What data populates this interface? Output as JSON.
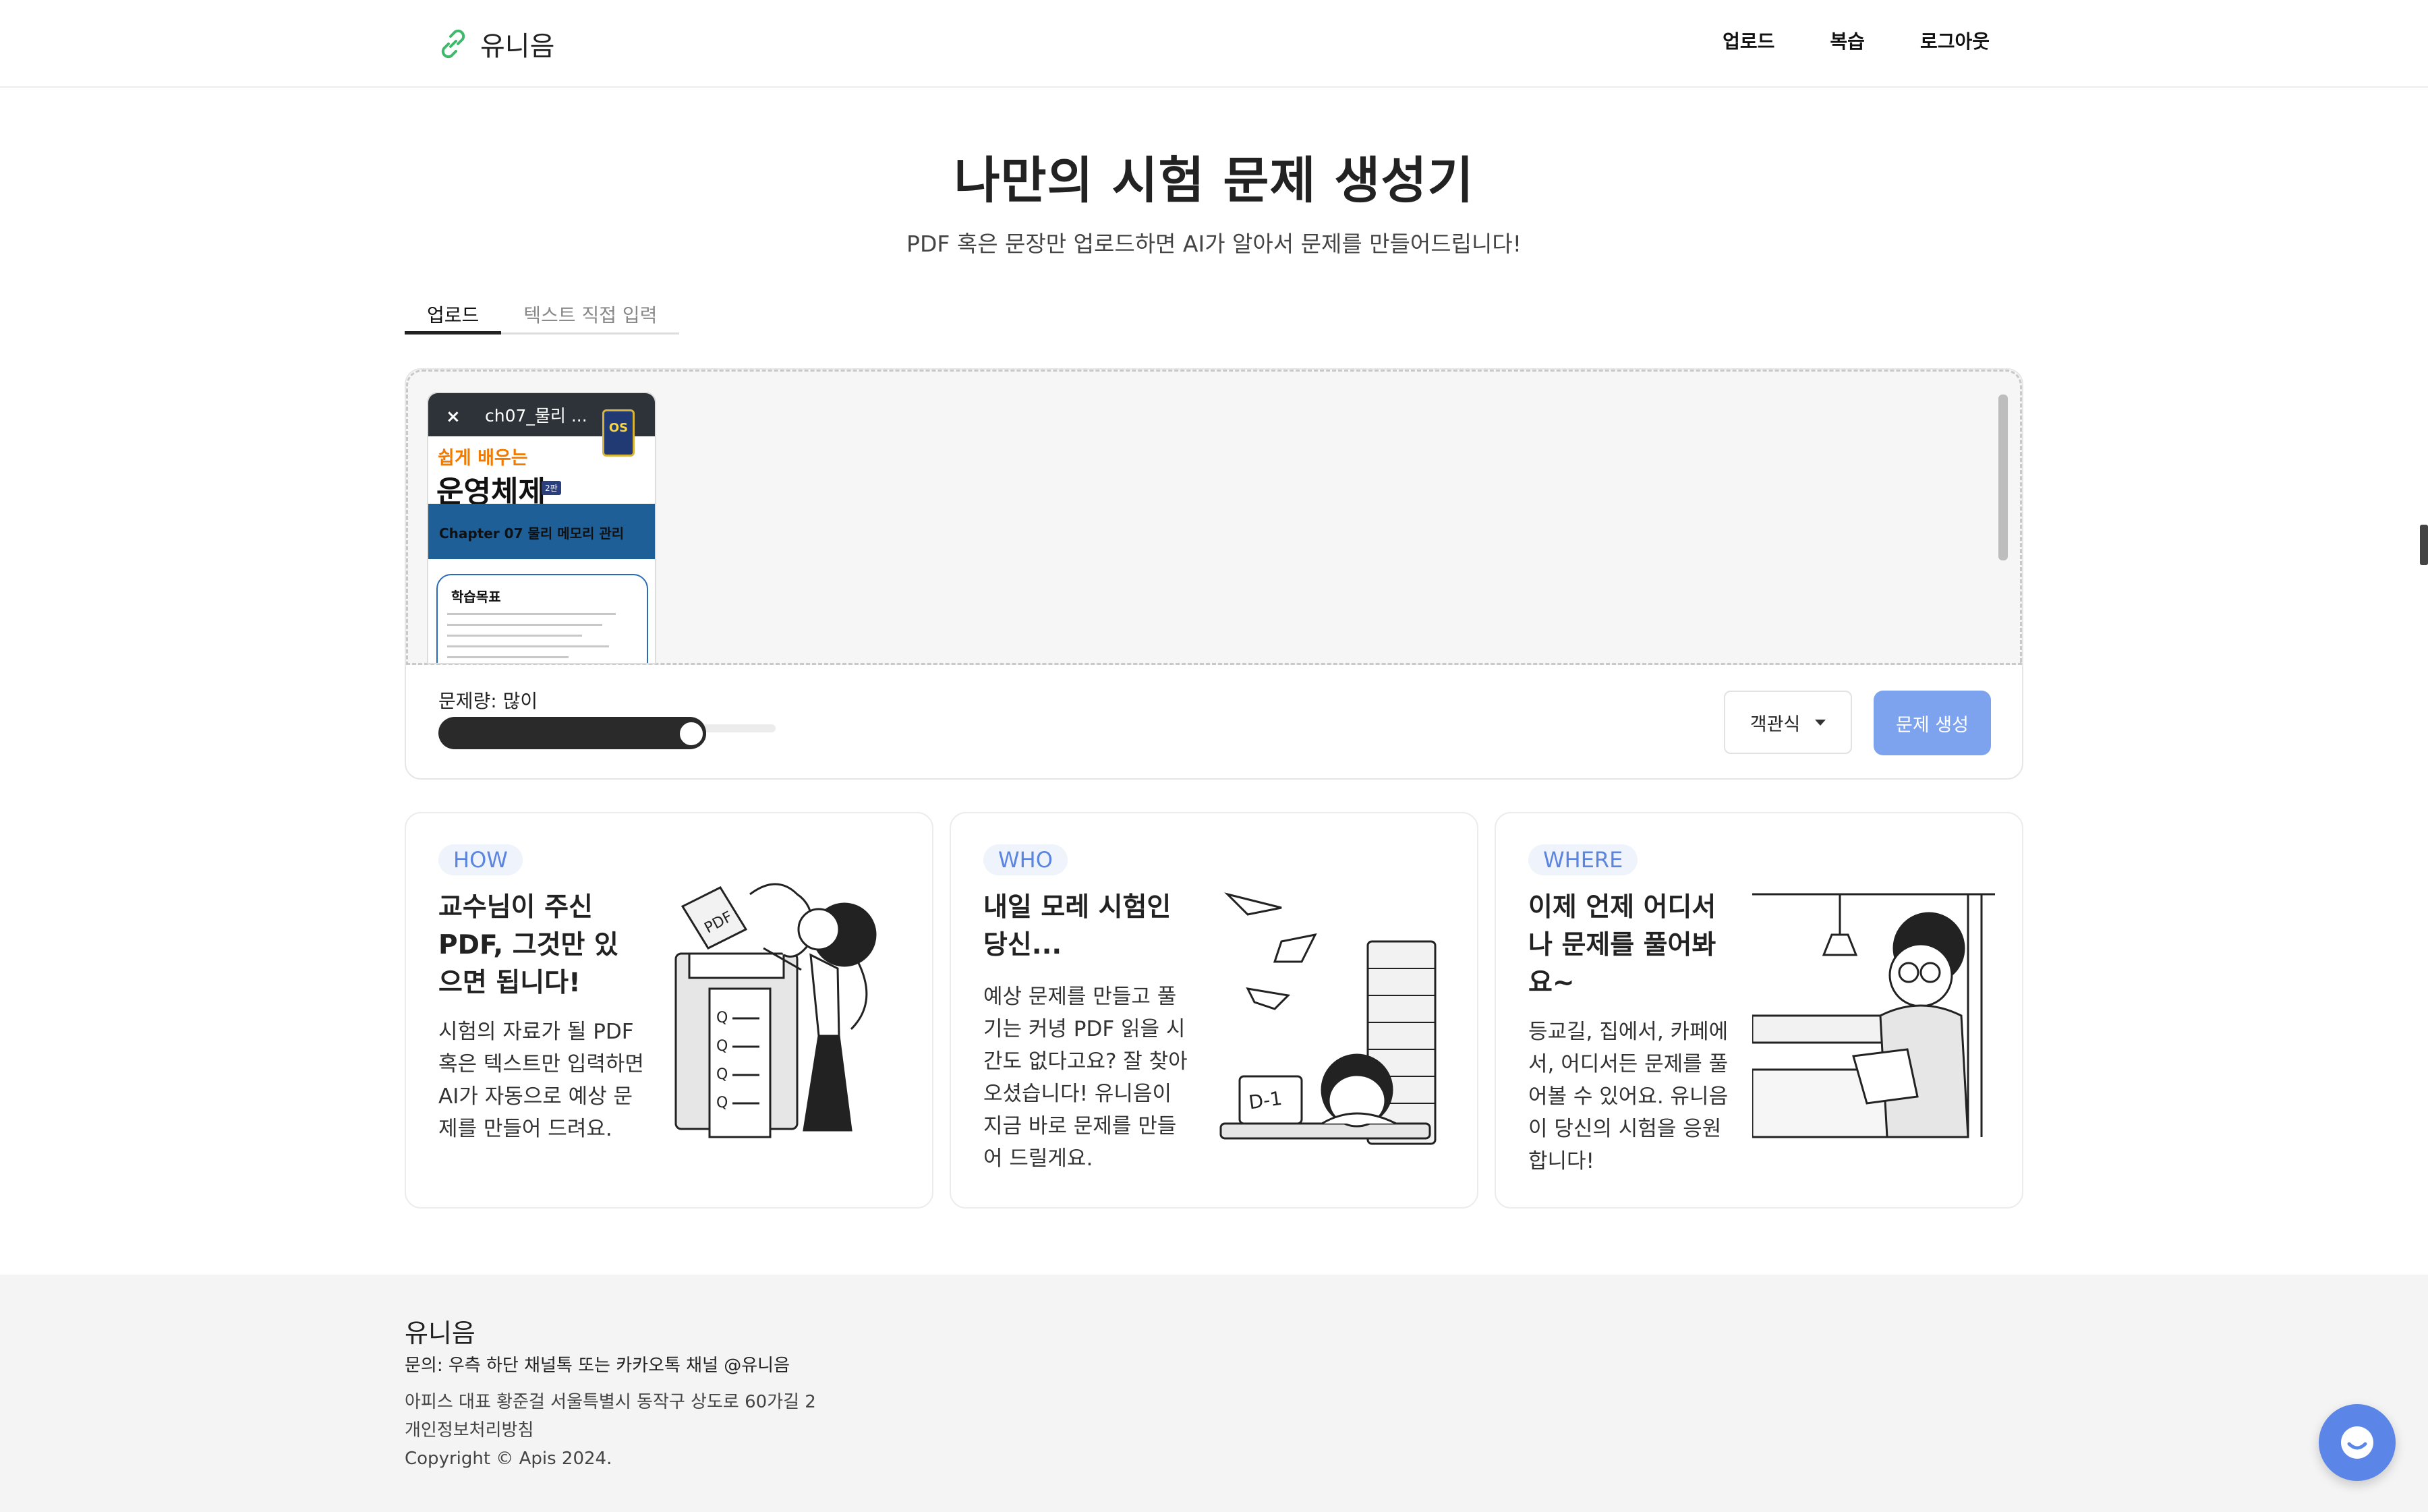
{
  "nav": {
    "brand": "유니음",
    "links": [
      "업로드",
      "복습",
      "로그아웃"
    ]
  },
  "hero": {
    "title": "나만의 시험 문제 생성기",
    "subtitle": "PDF 혹은 문장만 업로드하면 AI가 알아서 문제를 만들어드립니다!"
  },
  "tabs": [
    {
      "label": "업로드",
      "active": true
    },
    {
      "label": "텍스트 직접 입력",
      "active": false
    }
  ],
  "upload": {
    "file": {
      "name": "ch07_물리 ...",
      "close": "×",
      "thumb_badge": "OS",
      "thumb_subtitle": "쉽게 배우는",
      "thumb_title": "운영체제",
      "thumb_edition": "2판",
      "thumb_chapter": "Chapter 07 물리 메모리 관리",
      "thumb_box_title": "학습목표"
    },
    "quantity_label": "문제량: 많이",
    "quantity_level": 0.75,
    "question_type": "객관식",
    "generate_label": "문제 생성"
  },
  "cards": [
    {
      "tag": "HOW",
      "title": "교수님이 주신 PDF, 그것만 있으면 됩니다!",
      "body": "시험의 자료가 될 PDF 혹은 텍스트만 입력하면 AI가 자동으로 예상 문제를 만들어 드려요.",
      "illus_text": "PDF",
      "q_label": "Q"
    },
    {
      "tag": "WHO",
      "title": "내일 모레 시험인 당신...",
      "body": "예상 문제를 만들고 풀기는 커녕 PDF 읽을 시간도 없다고요? 잘 찾아오셨습니다! 유니음이 지금 바로 문제를 만들어 드릴게요.",
      "illus_text": "D-1"
    },
    {
      "tag": "WHERE",
      "title": "이제 언제 어디서나 문제를 풀어봐요~",
      "body": "등교길, 집에서, 카페에서, 어디서든 문제를 풀어볼 수 있어요. 유니음이 당신의 시험을 응원합니다!"
    }
  ],
  "footer": {
    "brand": "유니음",
    "contact": "문의: 우측 하단 채널톡 또는 카카오톡 채널 @유니음",
    "address": "아피스 대표 황준걸 서울특별시 동작구 상도로 60가길 2",
    "privacy": "개인정보처리방침",
    "copyright": "Copyright © Apis 2024."
  },
  "colors": {
    "accent": "#7da3ee",
    "tag_text": "#5b85df",
    "tag_bg": "#eef3fc",
    "logo_green": "#3fb96b"
  }
}
